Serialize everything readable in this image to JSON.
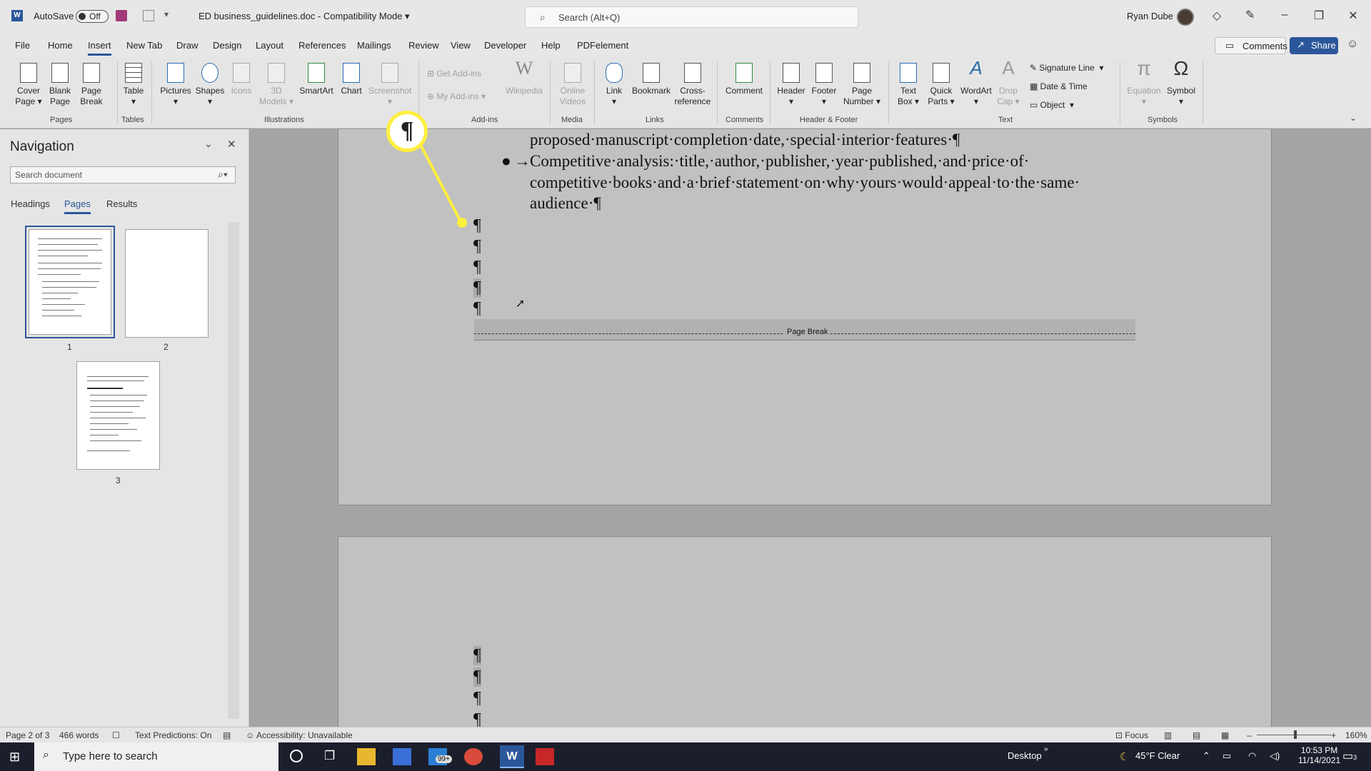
{
  "titlebar": {
    "autosave_label": "AutoSave",
    "autosave_state": "Off",
    "doc_title": "ED business_guidelines.doc - Compatibility Mode",
    "search_placeholder": "Search (Alt+Q)",
    "user_name": "Ryan Dube"
  },
  "menu": {
    "items": [
      "File",
      "Home",
      "Insert",
      "New Tab",
      "Draw",
      "Design",
      "Layout",
      "References",
      "Mailings",
      "Review",
      "View",
      "Developer",
      "Help",
      "PDFelement"
    ],
    "active": "Insert",
    "comments_label": "Comments",
    "share_label": "Share"
  },
  "ribbon": {
    "pages": {
      "cover": "Cover Page",
      "blank": "Blank Page",
      "break": "Page Break",
      "label": "Pages"
    },
    "tables": {
      "table": "Table",
      "label": "Tables"
    },
    "illustrations": {
      "pictures": "Pictures",
      "shapes": "Shapes",
      "icons": "Icons",
      "models": "3D Models",
      "smartart": "SmartArt",
      "chart": "Chart",
      "screenshot": "Screenshot",
      "label": "Illustrations"
    },
    "addins": {
      "get": "Get Add-ins",
      "my": "My Add-ins",
      "wikipedia": "Wikipedia",
      "label": "Add-ins"
    },
    "media": {
      "online_videos": "Online Videos",
      "label": "Media"
    },
    "links": {
      "link": "Link",
      "bookmark": "Bookmark",
      "crossref": "Cross-reference",
      "label": "Links"
    },
    "comments": {
      "comment": "Comment",
      "label": "Comments"
    },
    "header_footer": {
      "header": "Header",
      "footer": "Footer",
      "page_number": "Page Number",
      "label": "Header & Footer"
    },
    "text": {
      "textbox": "Text Box",
      "quickparts": "Quick Parts",
      "wordart": "WordArt",
      "dropcap": "Drop Cap",
      "signature": "Signature Line",
      "datetime": "Date & Time",
      "object": "Object",
      "label": "Text"
    },
    "symbols": {
      "equation": "Equation",
      "symbol": "Symbol",
      "label": "Symbols"
    }
  },
  "nav": {
    "title": "Navigation",
    "search_placeholder": "Search document",
    "tabs": [
      "Headings",
      "Pages",
      "Results"
    ],
    "active_tab": "Pages",
    "page_numbers": [
      "1",
      "2",
      "3"
    ]
  },
  "document": {
    "line1": "proposed·manuscript·completion·date,·special·interior·features·¶",
    "bullet": "●",
    "arrow": "→",
    "line2": "Competitive·analysis:·title,·author,·publisher,·year·published,·and·price·of·",
    "line3": "competitive·books·and·a·brief·statement·on·why·yours·would·appeal·to·the·same·",
    "line4": "audience·¶",
    "pilcrow": "¶",
    "page_break_label": "Page Break"
  },
  "callout": {
    "symbol": "¶",
    "color": "#ffef3f"
  },
  "statusbar": {
    "page": "Page 2 of 3",
    "words": "466 words",
    "predictions": "Text Predictions: On",
    "accessibility": "Accessibility: Unavailable",
    "focus": "Focus",
    "zoom": "160%"
  },
  "taskbar": {
    "search_placeholder": "Type here to search",
    "mail_badge": "99+",
    "desktop_label": "Desktop",
    "weather": "45°F  Clear",
    "time": "10:53 PM",
    "date": "11/14/2021",
    "notification_count": "3"
  },
  "colors": {
    "accent": "#2b579a",
    "highlight": "#ffef3f"
  }
}
